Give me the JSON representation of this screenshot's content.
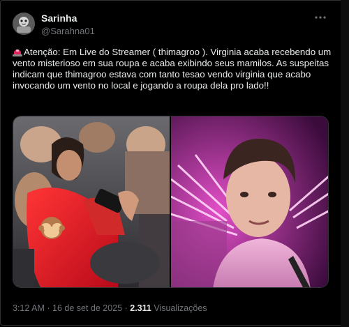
{
  "author": {
    "name": "Sarinha",
    "handle": "@Sarahna01"
  },
  "tweet": {
    "text": "Atenção: Em Live do Streamer ( thimagroo ). Virginia acaba recebendo um vento misterioso em sua roupa e acaba exibindo seus mamilos. As suspeitas indicam que thimagroo estava com tanto tesao vendo virginia que acabo invocando um vento no local e jogando a roupa dela pro lado!!",
    "leading_icon": "siren-emoji"
  },
  "meta": {
    "time": "3:12 AM",
    "separator": "·",
    "date": "16 de set de 2025",
    "views_count": "2.311",
    "views_label": "Visualizações"
  },
  "colors": {
    "background": "#000000",
    "text": "#e7e9ea",
    "secondary": "#71767b",
    "border": "#2f3336",
    "pink_light": "#ff6fe0"
  },
  "icons": {
    "more": "more-dots-icon",
    "censor": "monkey-see-no-evil-emoji"
  }
}
